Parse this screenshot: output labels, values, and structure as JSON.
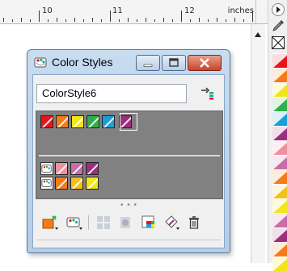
{
  "ruler": {
    "numbers": [
      "10",
      "11",
      "12"
    ],
    "unit": "inches"
  },
  "window": {
    "title": "Color Styles",
    "name_value": "ColorStyle6"
  },
  "styles": {
    "top_row": [
      "#e8141c",
      "#f57b18",
      "#f2e51a",
      "#2eb04a",
      "#1aa0d8",
      "#9b2f7c"
    ],
    "harmony_row1": [
      "#ef8fa0",
      "#c86ca8",
      "#9b2f7c"
    ],
    "harmony_row2": [
      "#f57b18",
      "#f4c01a",
      "#f2e51a"
    ]
  },
  "palette_colors": [
    "#e8141c",
    "#f57b18",
    "#f2e51a",
    "#2eb04a",
    "#1aa0d8",
    "#9b2f7c",
    "#ef8fa0",
    "#c86ca8",
    "#f57b18",
    "#f4c01a",
    "#f2e51a",
    "#c86ca8",
    "#9b2f7c",
    "#f57b18",
    "#f2e51a"
  ],
  "toolbar_icons": [
    "new-color-style-icon",
    "new-harmony-icon",
    "convert-to-harmony-icon",
    "edit-harmony-icon",
    "apply-to-selection-icon",
    "import-styles-icon",
    "delete-icon"
  ]
}
